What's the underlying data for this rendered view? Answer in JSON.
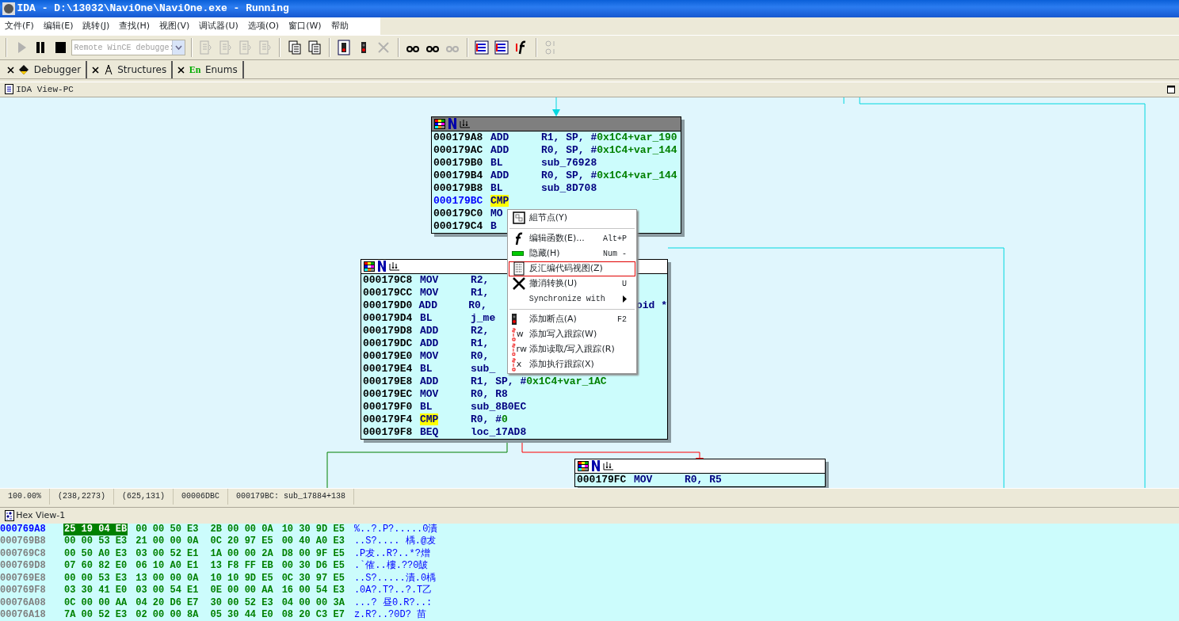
{
  "window": {
    "title": "IDA - D:\\13032\\NaviOne\\NaviOne.exe - Running"
  },
  "menu_bar": [
    "文件(F)",
    "编辑(E)",
    "跳转(J)",
    "查找(H)",
    "视图(V)",
    "调试器(U)",
    "选项(O)",
    "窗口(W)",
    "帮助"
  ],
  "toolbar": [
    {
      "kind": "play",
      "disabled": true
    },
    {
      "kind": "pause",
      "disabled": false
    },
    {
      "kind": "stop",
      "disabled": false
    },
    {
      "kind": "combo",
      "value": "Remote WinCE debugge:",
      "disabled": true
    },
    {
      "kind": "sep"
    },
    {
      "kind": "step",
      "disabled": true
    },
    {
      "kind": "step",
      "disabled": true
    },
    {
      "kind": "step",
      "disabled": true
    },
    {
      "kind": "step",
      "disabled": true
    },
    {
      "kind": "sep"
    },
    {
      "kind": "doc",
      "disabled": false
    },
    {
      "kind": "doc",
      "disabled": false
    },
    {
      "kind": "sep"
    },
    {
      "kind": "bplist",
      "disabled": false
    },
    {
      "kind": "bp",
      "disabled": false
    },
    {
      "kind": "delete",
      "disabled": true
    },
    {
      "kind": "sep"
    },
    {
      "kind": "watch",
      "disabled": false
    },
    {
      "kind": "watch",
      "disabled": false
    },
    {
      "kind": "watch",
      "disabled": true
    },
    {
      "kind": "sep"
    },
    {
      "kind": "list",
      "disabled": false
    },
    {
      "kind": "list",
      "disabled": false
    },
    {
      "kind": "func",
      "disabled": false
    },
    {
      "kind": "sep"
    },
    {
      "kind": "misc",
      "disabled": true
    }
  ],
  "tabs": [
    {
      "label": "Debugger",
      "kind": "debugger",
      "selected": false
    },
    {
      "label": "Structures",
      "kind": "structures",
      "selected": false
    },
    {
      "label": "Enums",
      "kind": "enums",
      "icon_text": "En",
      "selected": false
    }
  ],
  "ida_view": {
    "title": "IDA View-PC",
    "graph": {
      "nodes": [
        {
          "selected": true,
          "rows": [
            {
              "addr": "000179A8",
              "mnem": "ADD",
              "operand": "R1, SP, #",
              "const": "0x1C4+var_190"
            },
            {
              "addr": "000179AC",
              "mnem": "ADD",
              "operand": "R0, SP, #",
              "const": "0x1C4+var_144"
            },
            {
              "addr": "000179B0",
              "mnem": "BL",
              "operand": "sub_76928"
            },
            {
              "addr": "000179B4",
              "mnem": "ADD",
              "operand": "R0, SP, #",
              "const": "0x1C4+var_144"
            },
            {
              "addr": "000179B8",
              "mnem": "BL",
              "operand": "sub_8D708"
            },
            {
              "addr": "000179BC",
              "mnem": "CMP",
              "current": true,
              "highlight": true
            },
            {
              "addr": "000179C0",
              "mnem": "MO"
            },
            {
              "addr": "000179C4",
              "mnem": "B"
            }
          ]
        },
        {
          "selected": false,
          "rows": [
            {
              "addr": "000179C8",
              "mnem": "MOV",
              "operand": "R2,"
            },
            {
              "addr": "000179CC",
              "mnem": "MOV",
              "operand": "R1,"
            },
            {
              "addr": "000179D0",
              "mnem": "ADD",
              "operand": "R0,",
              "tail": "oid *"
            },
            {
              "addr": "000179D4",
              "mnem": "BL",
              "operand": "j_me"
            },
            {
              "addr": "000179D8",
              "mnem": "ADD",
              "operand": "R2,"
            },
            {
              "addr": "000179DC",
              "mnem": "ADD",
              "operand": "R1,"
            },
            {
              "addr": "000179E0",
              "mnem": "MOV",
              "operand": "R0,"
            },
            {
              "addr": "000179E4",
              "mnem": "BL",
              "operand": "sub_"
            },
            {
              "addr": "000179E8",
              "mnem": "ADD",
              "operand": "R1, SP, #",
              "const": "0x1C4+var_1AC"
            },
            {
              "addr": "000179EC",
              "mnem": "MOV",
              "operand": "R0, R8"
            },
            {
              "addr": "000179F0",
              "mnem": "BL",
              "operand": "sub_8B0EC"
            },
            {
              "addr": "000179F4",
              "mnem": "CMP",
              "operand": "R0, #",
              "const": "0",
              "highlight": true
            },
            {
              "addr": "000179F8",
              "mnem": "BEQ",
              "operand": "loc_17AD8"
            }
          ]
        },
        {
          "selected": false,
          "rows": [
            {
              "addr": "000179FC",
              "mnem": "MOV",
              "operand": "R0, R5"
            }
          ]
        }
      ]
    },
    "context_menu": [
      {
        "kind": "group",
        "label": "組节点(Y)",
        "selected": false
      },
      {
        "kind": "sep"
      },
      {
        "kind": "func",
        "label": "编辑函数(E)...",
        "shortcut": "Alt+P",
        "selected": false
      },
      {
        "kind": "hide",
        "label": "隐藏(H)",
        "shortcut": "Num -",
        "selected": false
      },
      {
        "kind": "disasm",
        "label": "反汇编代码视图(Z)",
        "selected": true
      },
      {
        "kind": "undo",
        "label": "撤消转换(U)",
        "shortcut": "U",
        "selected": false
      },
      {
        "kind": "none",
        "label": "Synchronize with",
        "submenu": true,
        "selected": false
      },
      {
        "kind": "sep"
      },
      {
        "kind": "bp",
        "label": "添加断点(A)",
        "shortcut": "F2",
        "selected": false
      },
      {
        "kind": "trace",
        "tag": "w",
        "label": "添加写入跟踪(W)",
        "selected": false
      },
      {
        "kind": "trace",
        "tag": "rw",
        "label": "添加读取/写入跟踪(R)",
        "selected": false
      },
      {
        "kind": "trace",
        "tag": "x",
        "label": "添加执行跟踪(X)",
        "selected": false
      }
    ]
  },
  "status_bar": [
    "100.00%",
    "(238,2273)",
    "(625,131)",
    "00006DBC",
    "000179BC: sub_17884+138"
  ],
  "hex_view": {
    "title": "Hex View-1",
    "rows": [
      {
        "addr": "000769A8",
        "selected": true,
        "hex": [
          "25 19 04 EB",
          "00 00 50 E3",
          "2B 00 00 0A",
          "10 30 9D E5"
        ],
        "ascii": "%..?.P?.....0漬"
      },
      {
        "addr": "000769B8",
        "selected": false,
        "hex": [
          "00 00 53 E3",
          "21 00 00 0A",
          "0C 20 97 E5",
          "00 40 A0 E3"
        ],
        "ascii": "..S?.... 楀.@犮"
      },
      {
        "addr": "000769C8",
        "selected": false,
        "hex": [
          "00 50 A0 E3",
          "03 00 52 E1",
          "1A 00 00 2A",
          "D8 00 9F E5"
        ],
        "ascii": ".P犮..R?..*?熷"
      },
      {
        "addr": "000769D8",
        "selected": false,
        "hex": [
          "07 60 82 E0",
          "06 10 A0 E1",
          "13 F8 FF EB",
          "00 30 D6 E5"
        ],
        "ascii": ".`傕..樓.??0皷"
      },
      {
        "addr": "000769E8",
        "selected": false,
        "hex": [
          "00 00 53 E3",
          "13 00 00 0A",
          "10 10 9D E5",
          "0C 30 97 E5"
        ],
        "ascii": "..S?.....漬.0楀"
      },
      {
        "addr": "000769F8",
        "selected": false,
        "hex": [
          "03 30 41 E0",
          "03 00 54 E1",
          "0E 00 00 AA",
          "16 00 54 E3"
        ],
        "ascii": ".0A?.T?..?.T乙"
      },
      {
        "addr": "00076A08",
        "selected": false,
        "hex": [
          "0C 00 00 AA",
          "04 20 D6 E7",
          "30 00 52 E3",
          "04 00 00 3A"
        ],
        "ascii": "...? 昼0.R?..:"
      },
      {
        "addr": "00076A18",
        "selected": false,
        "hex": [
          "7A 00 52 E3",
          "02 00 00 8A",
          "05 30 44 E0",
          "08 20 C3 E7"
        ],
        "ascii": "z.R?..?0D? 苗"
      }
    ]
  }
}
